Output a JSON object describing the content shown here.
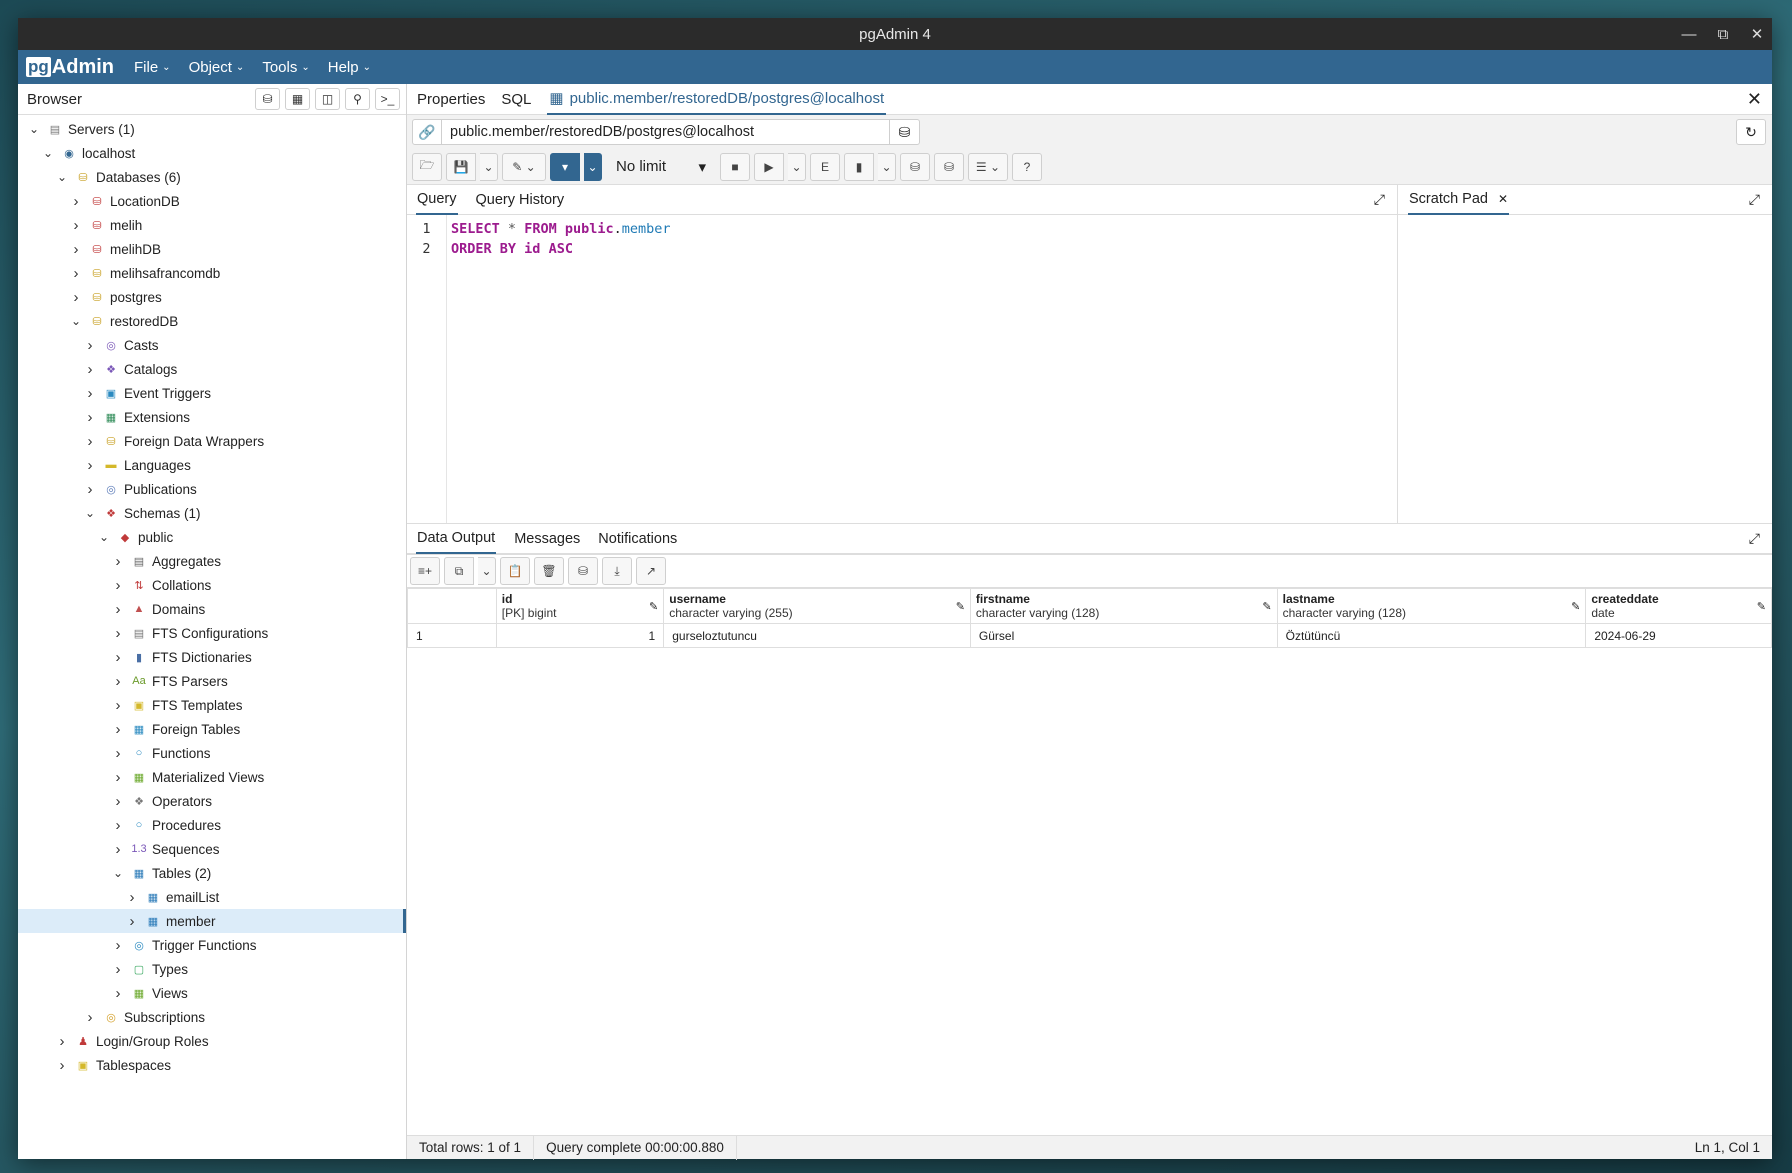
{
  "window": {
    "title": "pgAdmin 4"
  },
  "menu": {
    "items": [
      "File",
      "Object",
      "Tools",
      "Help"
    ],
    "logo_pg": "pg",
    "logo_admin": "Admin"
  },
  "sidebar": {
    "title": "Browser",
    "tree": [
      {
        "label": "Servers (1)",
        "level": 0,
        "state": "open",
        "icon": "servers-icon"
      },
      {
        "label": "localhost",
        "level": 1,
        "state": "open",
        "icon": "server-icon"
      },
      {
        "label": "Databases (6)",
        "level": 2,
        "state": "open",
        "icon": "databases-icon"
      },
      {
        "label": "LocationDB",
        "level": 3,
        "state": "closed",
        "icon": "database-disconnected-icon"
      },
      {
        "label": "melih",
        "level": 3,
        "state": "closed",
        "icon": "database-disconnected-icon"
      },
      {
        "label": "melihDB",
        "level": 3,
        "state": "closed",
        "icon": "database-disconnected-icon"
      },
      {
        "label": "melihsafrancomdb",
        "level": 3,
        "state": "closed",
        "icon": "database-icon"
      },
      {
        "label": "postgres",
        "level": 3,
        "state": "closed",
        "icon": "database-icon"
      },
      {
        "label": "restoredDB",
        "level": 3,
        "state": "open",
        "icon": "database-icon"
      },
      {
        "label": "Casts",
        "level": 4,
        "state": "closed",
        "icon": "casts-icon"
      },
      {
        "label": "Catalogs",
        "level": 4,
        "state": "closed",
        "icon": "catalogs-icon"
      },
      {
        "label": "Event Triggers",
        "level": 4,
        "state": "closed",
        "icon": "event-triggers-icon"
      },
      {
        "label": "Extensions",
        "level": 4,
        "state": "closed",
        "icon": "extensions-icon"
      },
      {
        "label": "Foreign Data Wrappers",
        "level": 4,
        "state": "closed",
        "icon": "fdw-icon"
      },
      {
        "label": "Languages",
        "level": 4,
        "state": "closed",
        "icon": "languages-icon"
      },
      {
        "label": "Publications",
        "level": 4,
        "state": "closed",
        "icon": "publications-icon"
      },
      {
        "label": "Schemas (1)",
        "level": 4,
        "state": "open",
        "icon": "schemas-icon"
      },
      {
        "label": "public",
        "level": 5,
        "state": "open",
        "icon": "schema-icon"
      },
      {
        "label": "Aggregates",
        "level": 6,
        "state": "closed",
        "icon": "aggregates-icon"
      },
      {
        "label": "Collations",
        "level": 6,
        "state": "closed",
        "icon": "collations-icon"
      },
      {
        "label": "Domains",
        "level": 6,
        "state": "closed",
        "icon": "domains-icon"
      },
      {
        "label": "FTS Configurations",
        "level": 6,
        "state": "closed",
        "icon": "fts-config-icon"
      },
      {
        "label": "FTS Dictionaries",
        "level": 6,
        "state": "closed",
        "icon": "fts-dict-icon"
      },
      {
        "label": "FTS Parsers",
        "level": 6,
        "state": "closed",
        "icon": "fts-parsers-icon"
      },
      {
        "label": "FTS Templates",
        "level": 6,
        "state": "closed",
        "icon": "fts-templates-icon"
      },
      {
        "label": "Foreign Tables",
        "level": 6,
        "state": "closed",
        "icon": "foreign-tables-icon"
      },
      {
        "label": "Functions",
        "level": 6,
        "state": "closed",
        "icon": "functions-icon"
      },
      {
        "label": "Materialized Views",
        "level": 6,
        "state": "closed",
        "icon": "matviews-icon"
      },
      {
        "label": "Operators",
        "level": 6,
        "state": "closed",
        "icon": "operators-icon"
      },
      {
        "label": "Procedures",
        "level": 6,
        "state": "closed",
        "icon": "procedures-icon"
      },
      {
        "label": "Sequences",
        "level": 6,
        "state": "closed",
        "icon": "sequences-icon"
      },
      {
        "label": "Tables (2)",
        "level": 6,
        "state": "open",
        "icon": "tables-icon"
      },
      {
        "label": "emailList",
        "level": 7,
        "state": "closed",
        "icon": "table-icon"
      },
      {
        "label": "member",
        "level": 7,
        "state": "closed",
        "icon": "table-icon",
        "selected": true
      },
      {
        "label": "Trigger Functions",
        "level": 6,
        "state": "closed",
        "icon": "trigger-functions-icon"
      },
      {
        "label": "Types",
        "level": 6,
        "state": "closed",
        "icon": "types-icon"
      },
      {
        "label": "Views",
        "level": 6,
        "state": "closed",
        "icon": "views-icon"
      },
      {
        "label": "Subscriptions",
        "level": 4,
        "state": "closed",
        "icon": "subscriptions-icon"
      },
      {
        "label": "Login/Group Roles",
        "level": 2,
        "state": "closed",
        "icon": "roles-icon"
      },
      {
        "label": "Tablespaces",
        "level": 2,
        "state": "closed",
        "icon": "tablespaces-icon"
      }
    ]
  },
  "tabs": {
    "properties": "Properties",
    "sql": "SQL",
    "active": "public.member/restoredDB/postgres@localhost"
  },
  "connection": {
    "value": "public.member/restoredDB/postgres@localhost"
  },
  "toolbar": {
    "limit": "No limit"
  },
  "query": {
    "tab_query": "Query",
    "tab_history": "Query History",
    "scratch_pad": "Scratch Pad",
    "line_numbers": [
      "1",
      "2"
    ],
    "line1": {
      "kw1": "SELECT",
      "op": "*",
      "kw2": "FROM",
      "schema": "public",
      "dot": ".",
      "table": "member"
    },
    "line2": {
      "kw1": "ORDER BY",
      "col": "id",
      "kw2": "ASC"
    }
  },
  "results": {
    "tab_output": "Data Output",
    "tab_messages": "Messages",
    "tab_notifications": "Notifications",
    "columns": [
      {
        "name": "id",
        "type": "[PK] bigint"
      },
      {
        "name": "username",
        "type": "character varying (255)"
      },
      {
        "name": "firstname",
        "type": "character varying (128)"
      },
      {
        "name": "lastname",
        "type": "character varying (128)"
      },
      {
        "name": "createddate",
        "type": "date"
      }
    ],
    "rows": [
      {
        "rownum": "1",
        "cells": [
          "1",
          "gurseloztutuncu",
          "Gürsel",
          "Öztütüncü",
          "2024-06-29"
        ]
      }
    ]
  },
  "status": {
    "rows": "Total rows: 1 of 1",
    "complete": "Query complete 00:00:00.880",
    "position": "Ln 1, Col 1"
  }
}
